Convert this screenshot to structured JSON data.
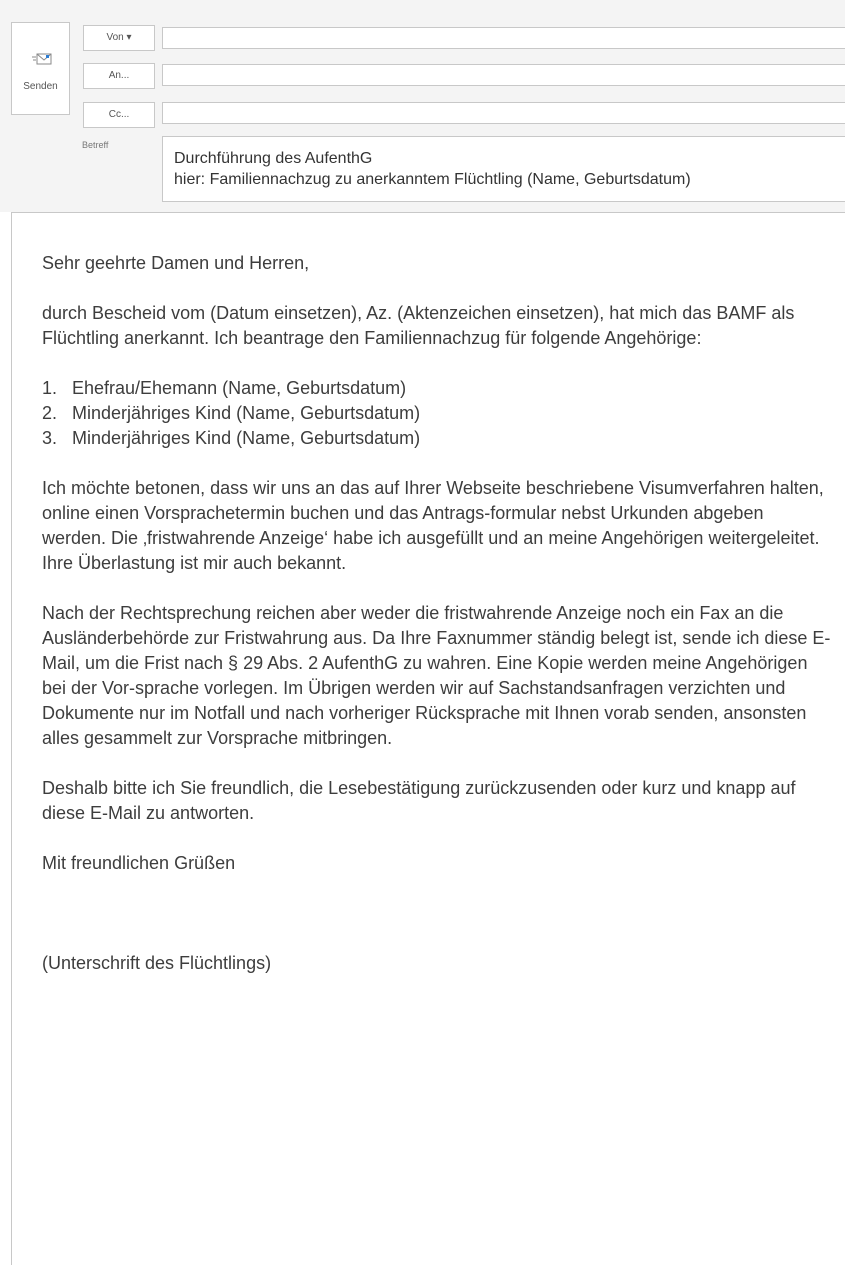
{
  "toolbar": {
    "send_label": "Senden",
    "send_icon": "send-envelope-icon"
  },
  "header": {
    "from_label": "Von ▾",
    "from_value": "",
    "to_label": "An...",
    "to_value": "",
    "cc_label": "Cc...",
    "cc_value": "",
    "subject_label": "Betreff",
    "subject_lines": [
      "Durchführung des AufenthG",
      "hier: Familiennachzug zu anerkanntem Flüchtling (Name, Geburtsdatum)"
    ]
  },
  "body": {
    "greeting": "Sehr geehrte Damen und Herren,",
    "intro": "durch Bescheid vom (Datum einsetzen), Az. (Aktenzeichen einsetzen), hat mich das BAMF als Flüchtling anerkannt. Ich beantrage den Familiennachzug für folgende Angehörige:",
    "family_list": [
      {
        "number": "1.",
        "text": "Ehefrau/Ehemann (Name, Geburtsdatum)"
      },
      {
        "number": "2.",
        "text": "Minderjähriges Kind (Name, Geburtsdatum)"
      },
      {
        "number": "3.",
        "text": "Minderjähriges Kind (Name, Geburtsdatum)"
      }
    ],
    "paragraph_procedure": "Ich möchte betonen, dass wir uns an das auf Ihrer Webseite beschriebene Visumverfahren halten, online einen Vorsprachetermin buchen und das Antrags-formular nebst Urkunden abgeben werden. Die ‚fristwahrende Anzeige‘ habe ich ausgefüllt und an meine Angehörigen weitergeleitet. Ihre Überlastung ist mir auch bekannt.",
    "paragraph_law": "Nach der Rechtsprechung reichen aber weder die fristwahrende Anzeige noch ein Fax an die Ausländerbehörde zur Fristwahrung aus. Da Ihre Faxnummer ständig belegt ist, sende ich diese E-Mail, um die Frist nach § 29 Abs. 2 AufenthG zu wahren. Eine Kopie werden meine Angehörigen bei der Vor-sprache vorlegen. Im Übrigen werden wir auf Sachstandsanfragen verzichten und Dokumente nur im Notfall und nach vorheriger Rücksprache mit Ihnen vorab senden, ansonsten alles gesammelt zur Vorsprache mitbringen.",
    "paragraph_request": "Deshalb bitte ich Sie freundlich, die Lesebestätigung zurückzusenden oder kurz und knapp auf diese E-Mail zu antworten.",
    "closing": "Mit freundlichen Grüßen",
    "signature": "(Unterschrift des Flüchtlings)"
  }
}
